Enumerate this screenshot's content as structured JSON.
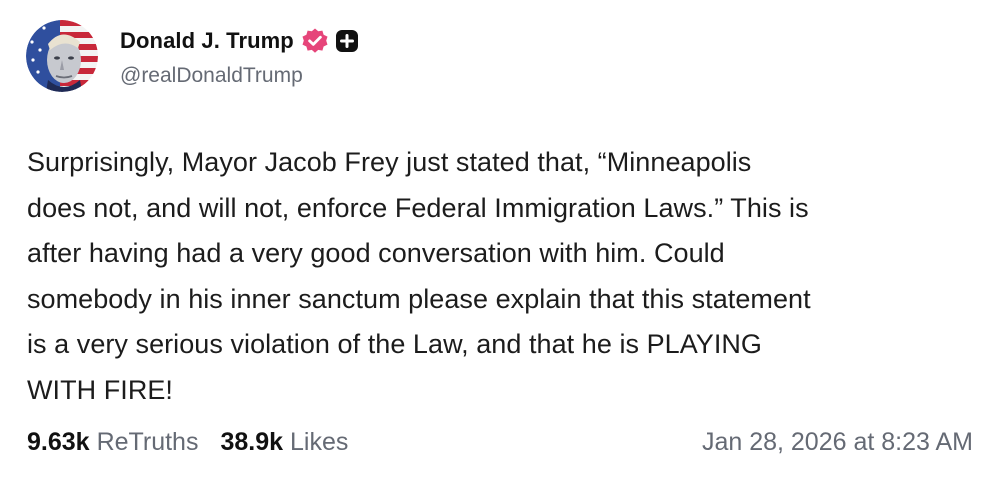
{
  "post": {
    "author": {
      "display_name": "Donald J. Trump",
      "handle": "@realDonaldTrump",
      "avatar_icon": "patriotic-portrait-avatar",
      "verified_icon": "verified-badge-icon",
      "plus_icon": "plus-badge-icon",
      "verified_color": "#e6457a",
      "plus_color": "#111111"
    },
    "text": "Surprisingly, Mayor Jacob Frey just stated that, “Minneapolis\ndoes not, and will not, enforce Federal Immigration Laws.” This is\nafter having had a very good conversation with him. Could\nsomebody in his inner sanctum please explain that this statement\nis a very serious violation of the Law, and that he is PLAYING\nWITH FIRE!",
    "retruths": {
      "count": "9.63k",
      "label": "ReTruths"
    },
    "likes": {
      "count": "38.9k",
      "label": "Likes"
    },
    "timestamp": "Jan 28, 2026 at 8:23 AM"
  }
}
